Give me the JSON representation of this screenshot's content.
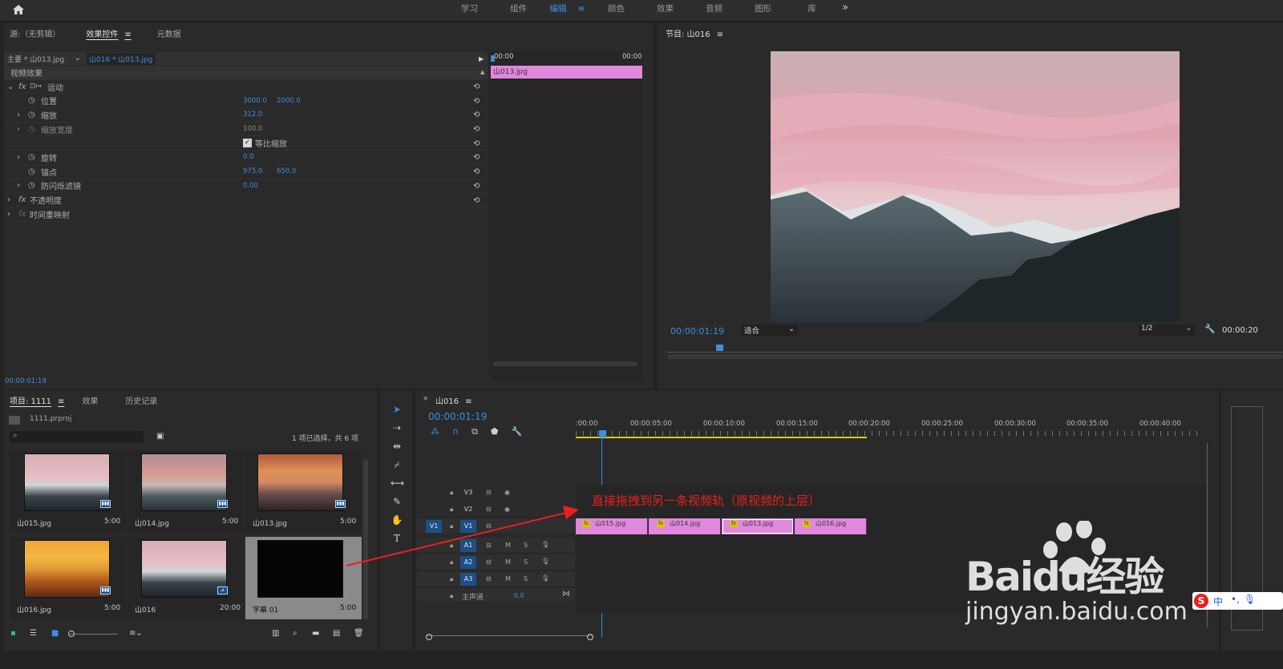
{
  "workspaces": [
    "学习",
    "组件",
    "编辑",
    "颜色",
    "效果",
    "音频",
    "图形",
    "库"
  ],
  "active_workspace": "编辑",
  "effect_panel": {
    "tabs": [
      "源:（无剪辑）",
      "效果控件",
      "元数据"
    ],
    "active_tab": "效果控件",
    "master_label": "主要 * 山013.jpg",
    "sequence_clip": "山016 * 山013.jpg",
    "section": "视频效果",
    "motion": "运动",
    "props": [
      {
        "name": "位置",
        "v1": "3000.0",
        "v2": "2000.0"
      },
      {
        "name": "缩放",
        "v1": "312.0",
        "v2": ""
      },
      {
        "name": "缩放宽度",
        "v1": "100.0",
        "v2": ""
      },
      {
        "name": "等比缩放",
        "v1": "",
        "v2": ""
      },
      {
        "name": "旋转",
        "v1": "0.0",
        "v2": ""
      },
      {
        "name": "锚点",
        "v1": "975.0",
        "v2": "650.0"
      },
      {
        "name": "防闪烁滤镜",
        "v1": "0.00",
        "v2": ""
      }
    ],
    "opacity": "不透明度",
    "time_remap": "时间重映射",
    "mini_timeline": {
      "start": "00:00",
      "end": "00:00",
      "clip": "山013.jpg"
    },
    "timecode": "00:00:01:19"
  },
  "program": {
    "title": "节目: 山016",
    "timecode": "00:00:01:19",
    "fit": "适合",
    "resolution": "1/2",
    "duration": "00:00:20"
  },
  "project": {
    "tabs": [
      "项目: 1111",
      "效果",
      "历史记录"
    ],
    "active_tab": "项目: 1111",
    "file": "1111.prproj",
    "selection_info": "1 项已选择，共 6 项",
    "search_placeholder": "",
    "items": [
      {
        "name": "山015.jpg",
        "dur": "5:00"
      },
      {
        "name": "山014.jpg",
        "dur": "5:00"
      },
      {
        "name": "山013.jpg",
        "dur": "5:00"
      },
      {
        "name": "山016.jpg",
        "dur": "5:00"
      },
      {
        "name": "山016",
        "dur": "20:00"
      },
      {
        "name": "字幕 01",
        "dur": "5:00"
      }
    ]
  },
  "timeline": {
    "title": "山016",
    "timecode": "00:00:01:19",
    "ruler": [
      ":00:00",
      "00:00:05:00",
      "00:00:10:00",
      "00:00:15:00",
      "00:00:20:00",
      "00:00:25:00",
      "00:00:30:00",
      "00:00:35:00",
      "00:00:40:00"
    ],
    "video_tracks": [
      "V3",
      "V2",
      "V1"
    ],
    "source_patch": "V1",
    "audio_tracks": [
      "A1",
      "A2",
      "A3"
    ],
    "audio_m": "M",
    "audio_s": "S",
    "master": "主声道",
    "master_val": "0.0",
    "clips": [
      "山015.jpg",
      "山014.jpg",
      "山013.jpg",
      "山016.jpg"
    ],
    "fx_label": "fx",
    "annotation": "直接拖拽到另一条视频轨（原视频的上层）"
  },
  "watermark": {
    "brand": "Baidu经验",
    "url": "jingyan.baidu.com"
  },
  "ime": {
    "logo": "S",
    "label": "中"
  },
  "colors": {
    "accent": "#3b8ee0",
    "clip": "#e088dc",
    "annotation": "#e8201c",
    "panel": "#2a2a2a"
  },
  "icons": [
    "home-icon",
    "menu-icon",
    "stopwatch-icon",
    "reset-icon",
    "selection-tool-icon",
    "razor-tool-icon",
    "pen-tool-icon",
    "hand-tool-icon",
    "type-tool-icon",
    "eye-icon",
    "lock-icon",
    "mic-icon",
    "wrench-icon",
    "play-icon",
    "camera-icon",
    "search-icon",
    "new-bin-icon",
    "trash-icon"
  ]
}
